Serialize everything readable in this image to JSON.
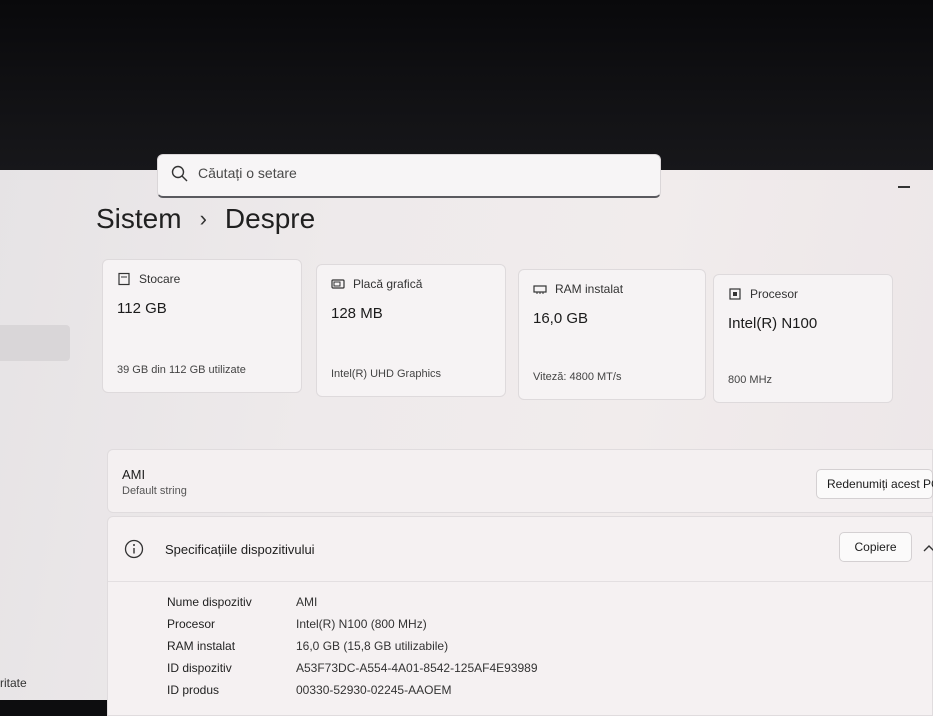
{
  "search": {
    "placeholder": "Căutați o setare"
  },
  "breadcrumb": {
    "parent": "Sistem",
    "separator": "›",
    "current": "Despre"
  },
  "cards": [
    {
      "icon": "storage-icon",
      "label": "Stocare",
      "value": "112 GB",
      "sub": "39 GB din 112 GB utilizate"
    },
    {
      "icon": "graphics-card-icon",
      "label": "Placă grafică",
      "value": "128 MB",
      "sub": "Intel(R) UHD Graphics"
    },
    {
      "icon": "ram-icon",
      "label": "RAM instalat",
      "value": "16,0 GB",
      "sub": "Viteză: 4800 MT/s"
    },
    {
      "icon": "processor-icon",
      "label": "Procesor",
      "value": "Intel(R) N100",
      "sub": "800 MHz"
    }
  ],
  "pc": {
    "name": "AMI",
    "description": "Default string",
    "rename_label": "Redenumiți acest PC"
  },
  "specs": {
    "title": "Specificațiile dispozitivului",
    "copy_label": "Copiere",
    "rows": [
      {
        "key": "Nume dispozitiv",
        "value": "AMI"
      },
      {
        "key": "Procesor",
        "value": "Intel(R) N100 (800 MHz)"
      },
      {
        "key": "RAM instalat",
        "value": "16,0 GB (15,8 GB utilizabile)"
      },
      {
        "key": "ID dispozitiv",
        "value": "A53F73DC-A554-4A01-8542-125AF4E93989"
      },
      {
        "key": "ID produs",
        "value": "00330-52930-02245-AAOEM"
      }
    ]
  },
  "sidebar": {
    "partial_item": "ritate"
  }
}
